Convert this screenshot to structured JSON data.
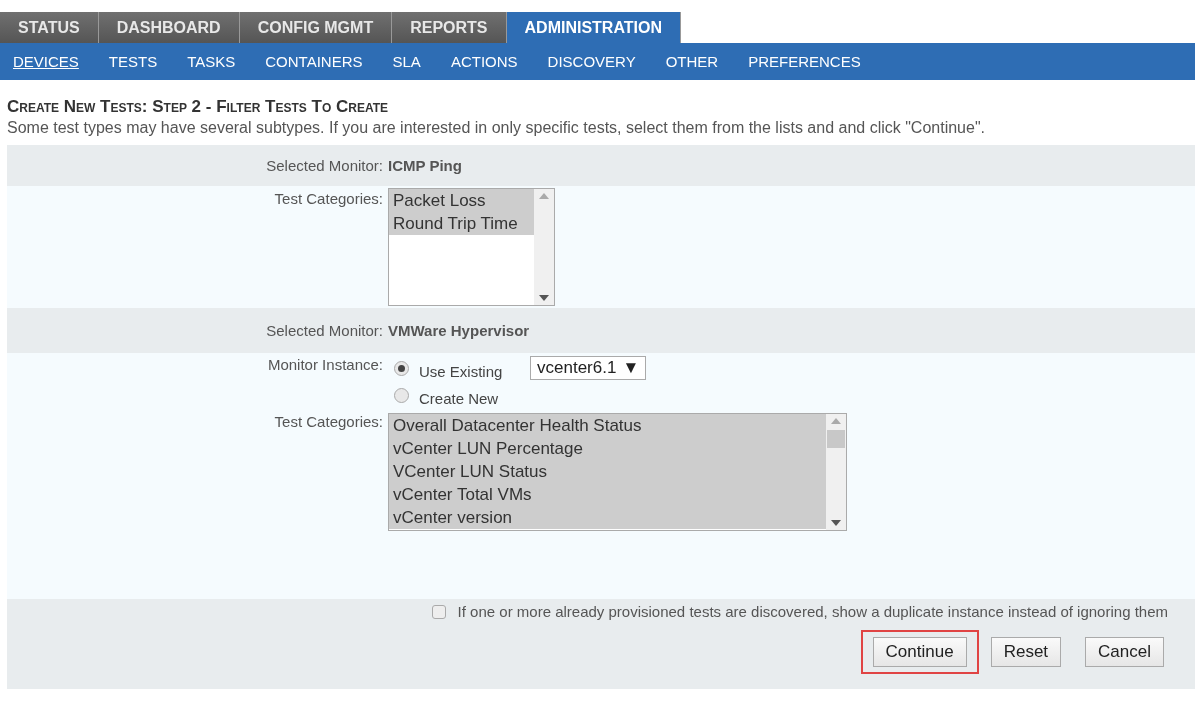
{
  "tabs": [
    {
      "label": "STATUS",
      "selected": false
    },
    {
      "label": "DASHBOARD",
      "selected": false
    },
    {
      "label": "CONFIG MGMT",
      "selected": false
    },
    {
      "label": "REPORTS",
      "selected": false
    },
    {
      "label": "ADMINISTRATION",
      "selected": true
    }
  ],
  "subnav": [
    {
      "label": "DEVICES",
      "selected": true
    },
    {
      "label": "TESTS",
      "selected": false
    },
    {
      "label": "TASKS",
      "selected": false
    },
    {
      "label": "CONTAINERS",
      "selected": false
    },
    {
      "label": "SLA",
      "selected": false
    },
    {
      "label": "ACTIONS",
      "selected": false
    },
    {
      "label": "DISCOVERY",
      "selected": false
    },
    {
      "label": "OTHER",
      "selected": false
    },
    {
      "label": "PREFERENCES",
      "selected": false
    }
  ],
  "title": "Create New Tests: Step 2 - Filter Tests To Create",
  "description": "Some test types may have several subtypes. If you are interested in only specific tests, select them from the lists and and click \"Continue\".",
  "monitors": [
    {
      "monitor_label": "Selected Monitor:",
      "name": "ICMP Ping",
      "categories_label": "Test Categories:",
      "categories": [
        {
          "label": "Packet Loss",
          "selected": true
        },
        {
          "label": "Round Trip Time",
          "selected": true
        }
      ]
    },
    {
      "monitor_label": "Selected Monitor:",
      "name": "VMWare Hypervisor",
      "instance": {
        "label": "Monitor Instance:",
        "options": [
          {
            "label": "Use Existing",
            "selected": true
          },
          {
            "label": "Create New",
            "selected": false
          }
        ],
        "dropdown": "vcenter6.1",
        "arrow": "▼"
      },
      "categories_label": "Test Categories:",
      "categories": [
        {
          "label": "Overall Datacenter Health Status",
          "selected": true
        },
        {
          "label": "vCenter LUN Percentage",
          "selected": true
        },
        {
          "label": "VCenter LUN Status",
          "selected": true
        },
        {
          "label": "vCenter Total VMs",
          "selected": true
        },
        {
          "label": "vCenter version",
          "selected": true
        }
      ]
    }
  ],
  "duplicate_option": {
    "label": "If one or more already provisioned tests are discovered, show a duplicate instance instead of ignoring them",
    "checked": false
  },
  "buttons": [
    {
      "label": "Continue",
      "highlighted": true
    },
    {
      "label": "Reset",
      "highlighted": false
    },
    {
      "label": "Cancel",
      "highlighted": false
    }
  ]
}
